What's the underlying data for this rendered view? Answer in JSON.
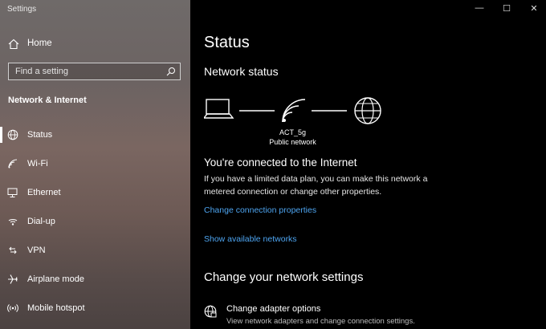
{
  "window": {
    "title": "Settings"
  },
  "sidebar": {
    "home_label": "Home",
    "search_placeholder": "Find a setting",
    "section_title": "Network & Internet",
    "items": [
      {
        "label": "Status",
        "icon": "globe-status-icon",
        "active": true
      },
      {
        "label": "Wi-Fi",
        "icon": "wifi-icon"
      },
      {
        "label": "Ethernet",
        "icon": "ethernet-icon"
      },
      {
        "label": "Dial-up",
        "icon": "dialup-icon"
      },
      {
        "label": "VPN",
        "icon": "vpn-icon"
      },
      {
        "label": "Airplane mode",
        "icon": "airplane-icon"
      },
      {
        "label": "Mobile hotspot",
        "icon": "hotspot-icon"
      }
    ]
  },
  "main": {
    "page_title": "Status",
    "network_status_heading": "Network status",
    "network_name": "ACT_5g",
    "network_type": "Public network",
    "connected_heading": "You're connected to the Internet",
    "connected_desc": "If you have a limited data plan, you can make this network a metered connection or change other properties.",
    "link_change_properties": "Change connection properties",
    "link_show_networks": "Show available networks",
    "change_settings_heading": "Change your network settings",
    "adapter_title": "Change adapter options",
    "adapter_subtitle": "View network adapters and change connection settings."
  },
  "colors": {
    "accent_link": "#4ea5f1",
    "main_bg": "#000000",
    "text": "#ffffff"
  }
}
